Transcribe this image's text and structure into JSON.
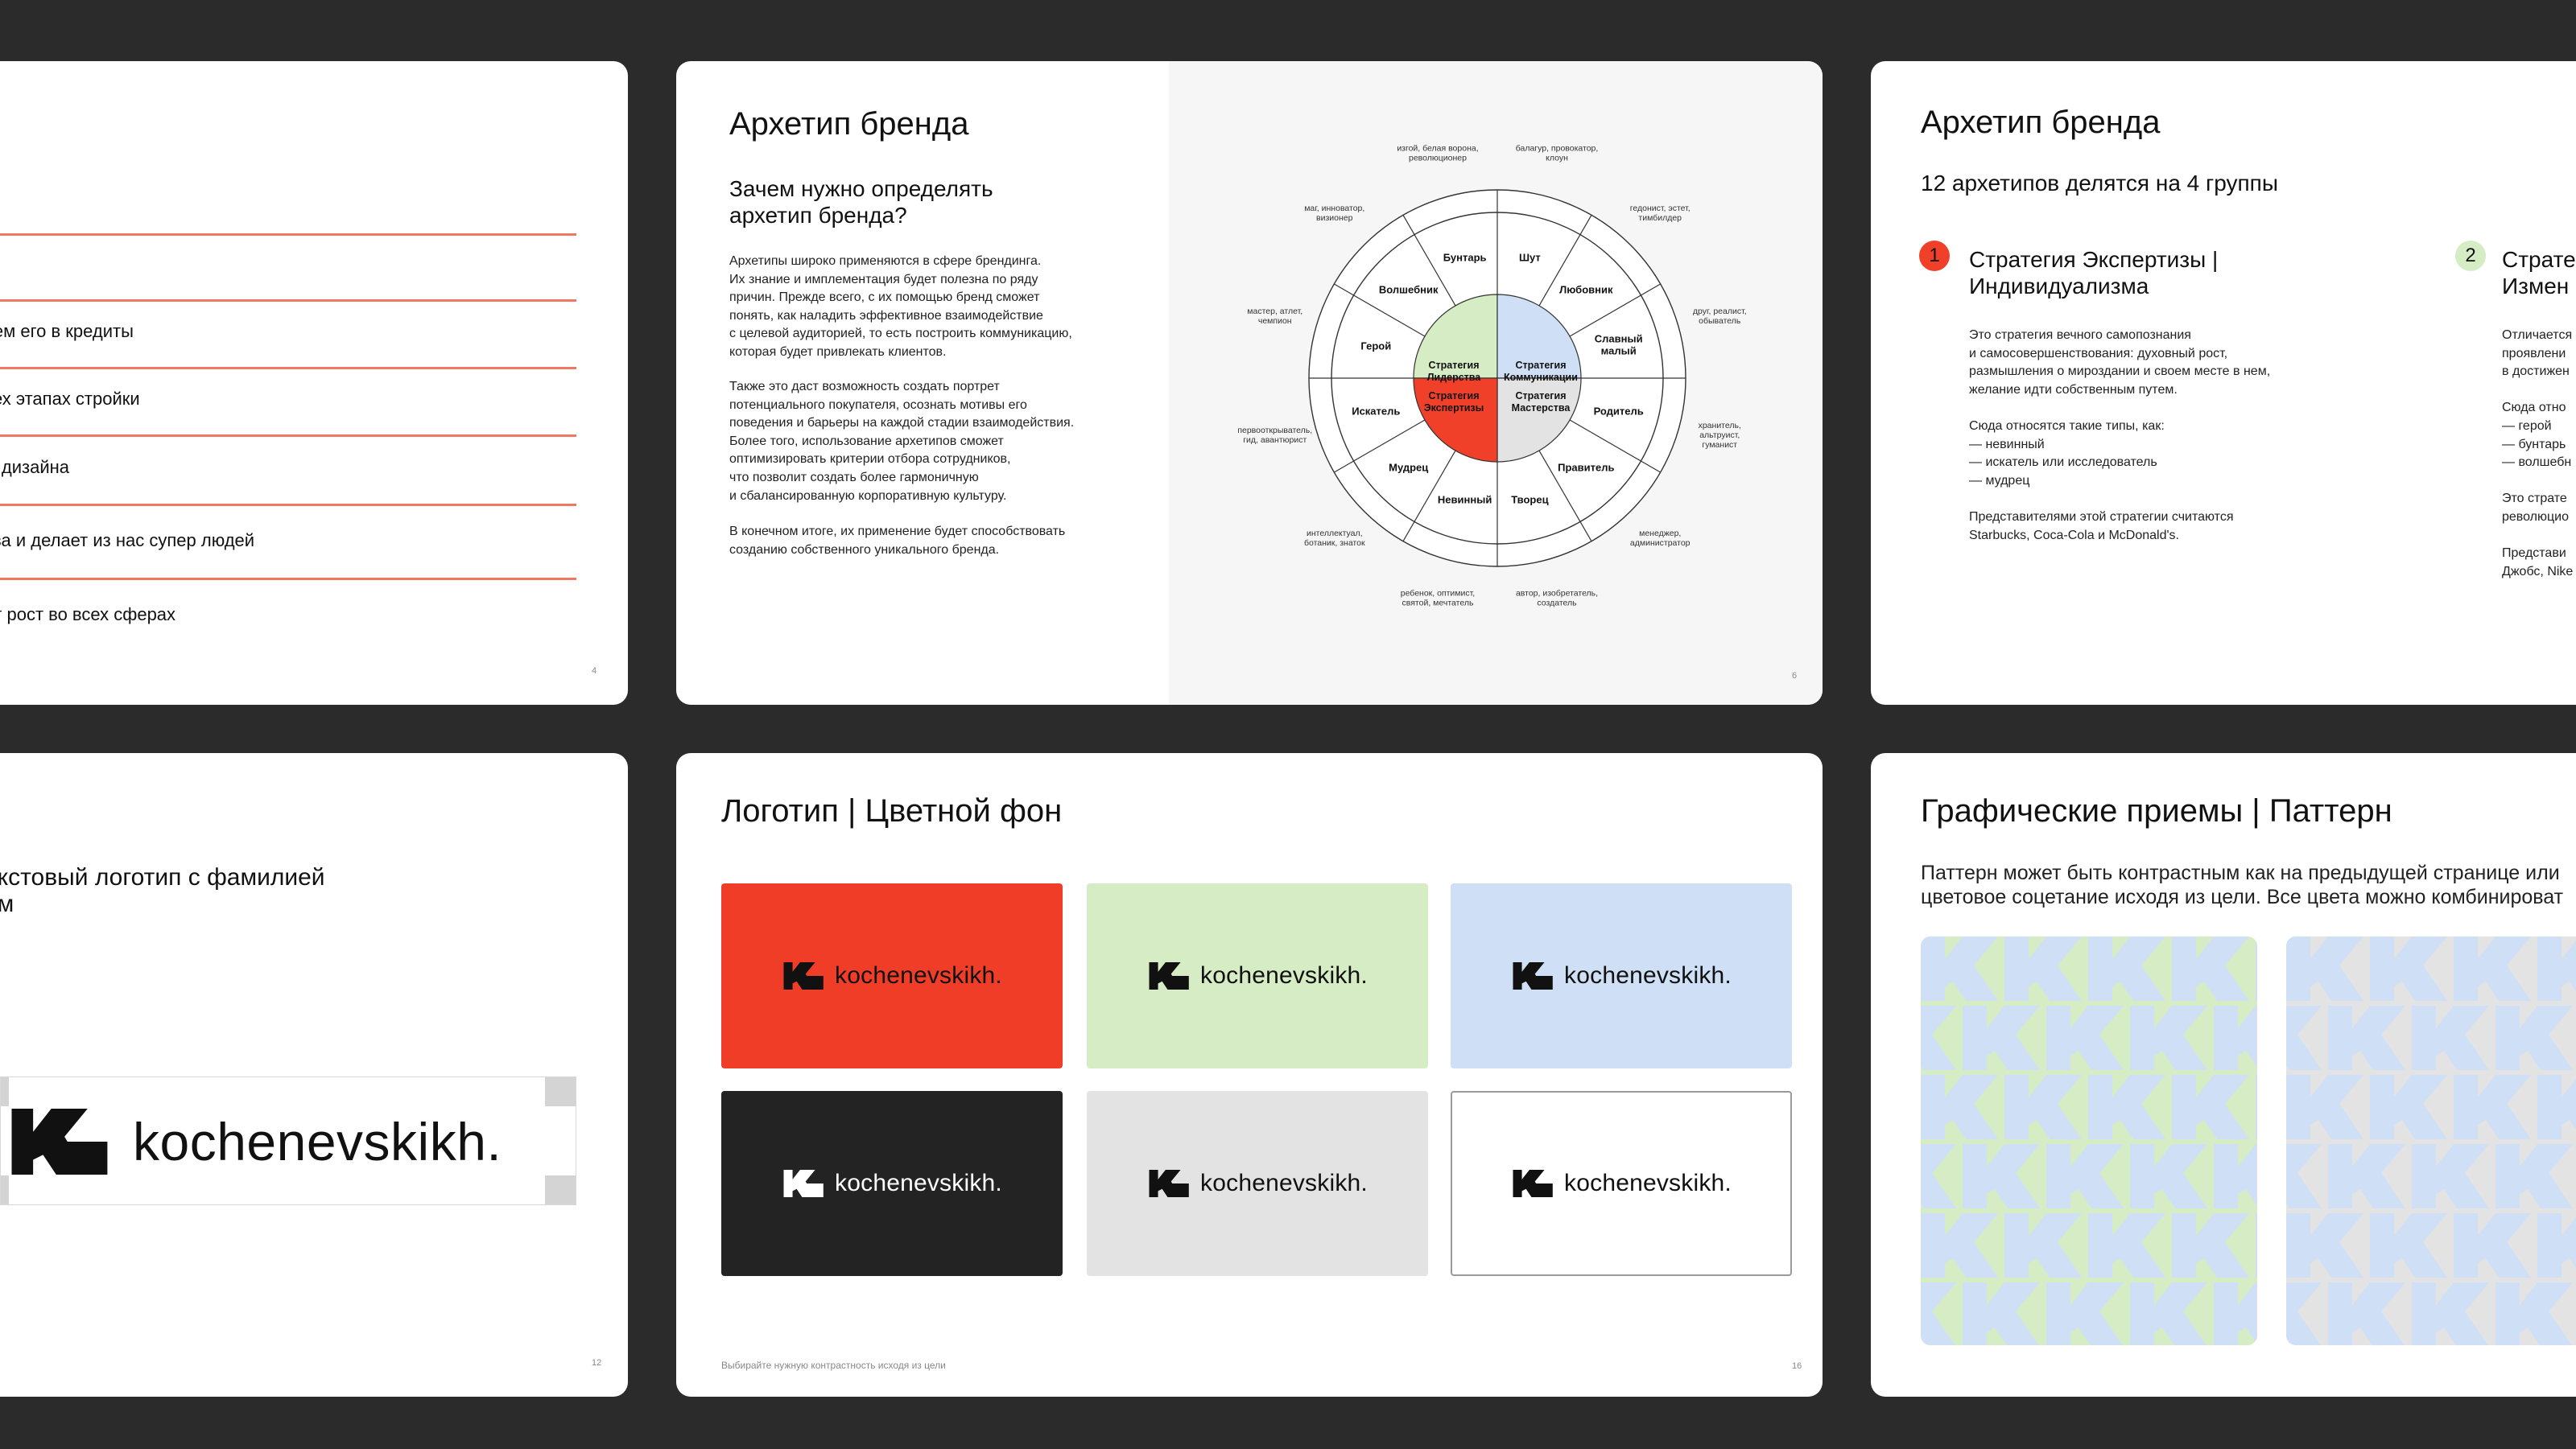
{
  "slide_1": {
    "items": [
      "яем его в кредиты",
      "сех этапах стройки",
      "ы дизайна",
      "тва и делает из нас супер людей",
      "ит рост во всех сферах"
    ],
    "page_number": "4"
  },
  "slide_2": {
    "title": "Архетип бренда",
    "subtitle_line1": "Зачем нужно определять",
    "subtitle_line2": "архетип бренда?",
    "para1": "Архетипы широко применяются в сфере брендинга.\nИх знание и имплементация будет полезна по ряду\nпричин. Прежде всего, с их помощью бренд сможет\nпонять, как наладить эффективное взаимодействие\nс целевой аудиторией, то есть построить коммуникацию,\nкоторая будет привлекать клиентов.",
    "para2": "Также это даст возможность создать портрет\nпотенциального покупателя, осознать мотивы его\nповедения и барьеры на каждой стадии взаимодействия.\nБолее того, использование архетипов сможет\nоптимизировать критерии отбора сотрудников,\nчто позволит создать более гармоничную\nи сбалансированную корпоративную культуру.",
    "para3": "В конечном итоге, их применение будет способствовать\nсозданию собственного уникального бренда.",
    "page_number": "6",
    "wheel": {
      "center": [
        {
          "l1": "Стратегия",
          "l2": "Лидерства",
          "color": "#d6ecc4"
        },
        {
          "l1": "Стратегия",
          "l2": "Коммуникации",
          "color": "#cfe0f6"
        },
        {
          "l1": "Стратегия",
          "l2": "Мастерства",
          "color": "#e3e3e3"
        },
        {
          "l1": "Стратегия",
          "l2": "Экспертизы",
          "color": "#f0402a"
        }
      ],
      "archetypes": [
        "Шут",
        "Любовник",
        "Славный",
        "малый",
        "Родитель",
        "Правитель",
        "Творец",
        "Невинный",
        "Мудрец",
        "Искатель",
        "Герой",
        "Волшебник",
        "Бунтарь"
      ],
      "descriptions": [
        [
          "балагур, провокатор,",
          "клоун"
        ],
        [
          "гедонист, эстет,",
          "тимбилдер"
        ],
        [
          "друг, реалист,",
          "обыватель"
        ],
        [
          "хранитель,",
          "альтруист,",
          "гуманист"
        ],
        [
          "менеджер,",
          "администратор"
        ],
        [
          "автор, изобретатель,",
          "создатель"
        ],
        [
          "ребенок, оптимист,",
          "святой, мечтатель"
        ],
        [
          "интеллектуал,",
          "ботаник, знаток"
        ],
        [
          "первооткрыватель,",
          "гид, авантюрист"
        ],
        [
          "мастер, атлет,",
          "чемпион"
        ],
        [
          "маг, инноватор,",
          "визионер"
        ],
        [
          "изгой, белая ворона,",
          "революционер"
        ]
      ]
    }
  },
  "slide_3": {
    "title": "Архетип бренда",
    "subtitle": "12 архетипов делятся на 4 группы",
    "group1": {
      "number": "1",
      "title_l1": "Стратегия Экспертизы |",
      "title_l2": "Индивидуализма",
      "text": "Это стратегия вечного самопознания\nи самосовершенствования: духовный рост,\nразмышления о мироздании и своем месте в нем,\nжелание идти собственным путем.\n\nСюда относятся такие типы, как:\n— невинный\n— искатель или исследователь\n— мудрец\n\nПредставителями этой стратегии считаются\nStarbucks, Coca-Cola и McDonald's."
    },
    "group2": {
      "number": "2",
      "title_l1": "Страте",
      "title_l2": "Измен",
      "text": "Отличается\nпроявлени\nв достижен\n\nСюда отно\n— герой\n— бунтарь\n— волшебн\n\nЭто страте\nреволюцио\n\nПредстави\nДжобс, Nike"
    },
    "colors": {
      "red": "#f0402a",
      "green": "#d6ecc4"
    }
  },
  "slide_4": {
    "text_l1": "екстовый логотип с фамилией",
    "text_l2": "ом",
    "logo_text": "kochenevskikh.",
    "page_number": "12"
  },
  "slide_5": {
    "title": "Логотип | Цветной фон",
    "cards": [
      {
        "bg": "#f03d28",
        "fg": "#111111",
        "border": "none",
        "text": "kochenevskikh."
      },
      {
        "bg": "#d6ecc4",
        "fg": "#111111",
        "border": "none",
        "text": "kochenevskikh."
      },
      {
        "bg": "#cfe0f6",
        "fg": "#111111",
        "border": "none",
        "text": "kochenevskikh."
      },
      {
        "bg": "#232323",
        "fg": "#ffffff",
        "border": "none",
        "text": "kochenevskikh."
      },
      {
        "bg": "#e3e3e3",
        "fg": "#111111",
        "border": "none",
        "text": "kochenevskikh."
      },
      {
        "bg": "#ffffff",
        "fg": "#111111",
        "border": "#9a9a9a",
        "text": "kochenevskikh."
      }
    ],
    "footer": "Выбирайте нужную контрастность исходя из цели",
    "page_number": "16"
  },
  "slide_6": {
    "title": "Графические приемы | Паттерн",
    "text_l1": "Паттерн может быть контрастным как на предыдущей странице или",
    "text_l2": "цветовое соцетание исходя из цели. Все цвета можно комбинироват",
    "pattern_colors": {
      "blue": "#cfe0f6",
      "green": "#d6ecc4",
      "gray": "#e3e3e3"
    }
  }
}
